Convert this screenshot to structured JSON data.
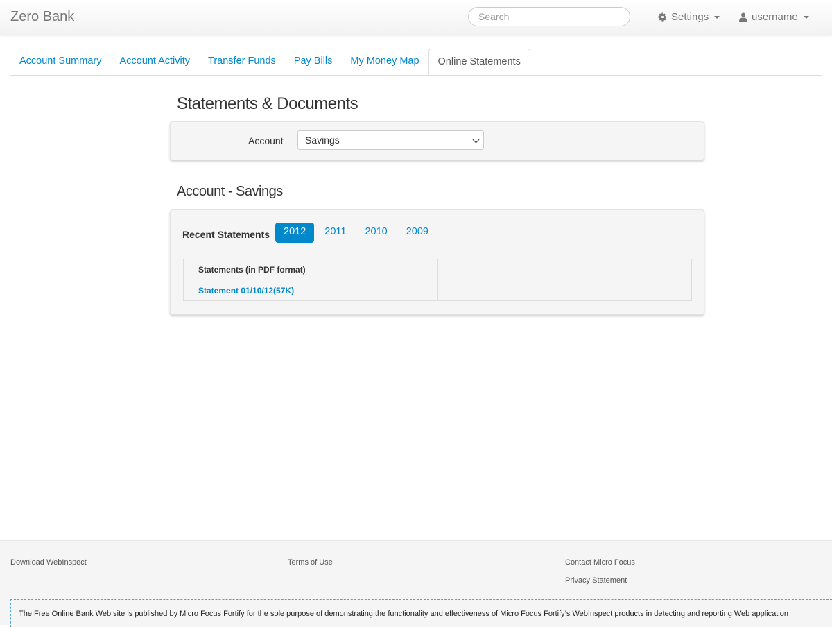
{
  "navbar": {
    "brand": "Zero Bank",
    "search_placeholder": "Search",
    "settings_label": "Settings",
    "user_label": "username"
  },
  "tabs": [
    {
      "label": "Account Summary"
    },
    {
      "label": "Account Activity"
    },
    {
      "label": "Transfer Funds"
    },
    {
      "label": "Pay Bills"
    },
    {
      "label": "My Money Map"
    },
    {
      "label": "Online Statements",
      "active": true
    }
  ],
  "main": {
    "title": "Statements & Documents",
    "account_label": "Account",
    "account_selected": "Savings",
    "section_title": "Account - Savings",
    "recent_label": "Recent Statements",
    "years": [
      "2012",
      "2011",
      "2010",
      "2009"
    ],
    "active_year": "2012",
    "table": {
      "header": "Statements (in PDF format)",
      "rows": [
        {
          "link": "Statement 01/10/12(57K)"
        }
      ]
    }
  },
  "footer": {
    "download": "Download WebInspect",
    "terms": "Terms of Use",
    "contact": "Contact Micro Focus",
    "privacy": "Privacy Statement",
    "disclaimer": "The Free Online Bank Web site is published by Micro Focus Fortify for the sole purpose of demonstrating the functionality and effectiveness of Micro Focus Fortify’s WebInspect products in detecting and reporting Web application"
  },
  "colors": {
    "accent": "#0088cc",
    "brand_text": "#777777",
    "footer_bg": "#f5f5f5"
  }
}
